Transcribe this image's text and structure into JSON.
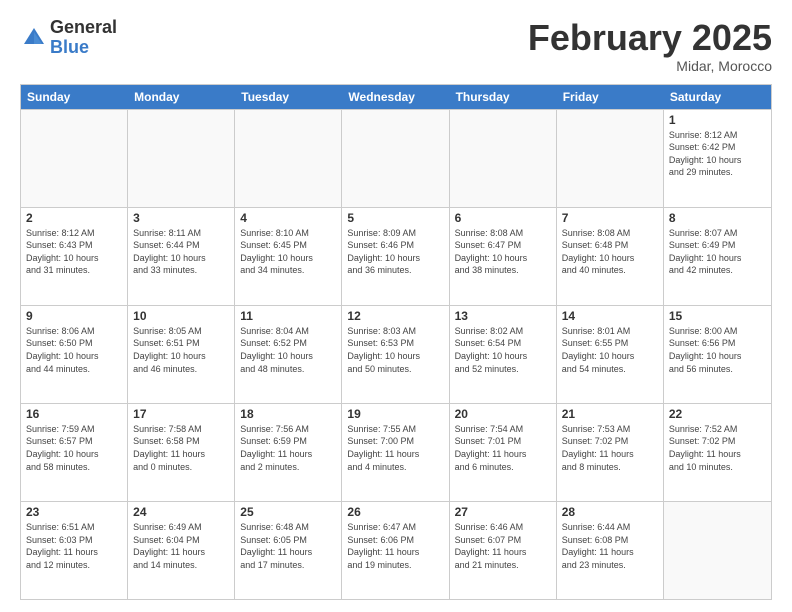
{
  "header": {
    "logo_general": "General",
    "logo_blue": "Blue",
    "title": "February 2025",
    "subtitle": "Midar, Morocco"
  },
  "calendar": {
    "days_of_week": [
      "Sunday",
      "Monday",
      "Tuesday",
      "Wednesday",
      "Thursday",
      "Friday",
      "Saturday"
    ],
    "rows": [
      [
        {
          "day": "",
          "info": "",
          "empty": true
        },
        {
          "day": "",
          "info": "",
          "empty": true
        },
        {
          "day": "",
          "info": "",
          "empty": true
        },
        {
          "day": "",
          "info": "",
          "empty": true
        },
        {
          "day": "",
          "info": "",
          "empty": true
        },
        {
          "day": "",
          "info": "",
          "empty": true
        },
        {
          "day": "1",
          "info": "Sunrise: 8:12 AM\nSunset: 6:42 PM\nDaylight: 10 hours\nand 29 minutes.",
          "empty": false
        }
      ],
      [
        {
          "day": "2",
          "info": "Sunrise: 8:12 AM\nSunset: 6:43 PM\nDaylight: 10 hours\nand 31 minutes.",
          "empty": false
        },
        {
          "day": "3",
          "info": "Sunrise: 8:11 AM\nSunset: 6:44 PM\nDaylight: 10 hours\nand 33 minutes.",
          "empty": false
        },
        {
          "day": "4",
          "info": "Sunrise: 8:10 AM\nSunset: 6:45 PM\nDaylight: 10 hours\nand 34 minutes.",
          "empty": false
        },
        {
          "day": "5",
          "info": "Sunrise: 8:09 AM\nSunset: 6:46 PM\nDaylight: 10 hours\nand 36 minutes.",
          "empty": false
        },
        {
          "day": "6",
          "info": "Sunrise: 8:08 AM\nSunset: 6:47 PM\nDaylight: 10 hours\nand 38 minutes.",
          "empty": false
        },
        {
          "day": "7",
          "info": "Sunrise: 8:08 AM\nSunset: 6:48 PM\nDaylight: 10 hours\nand 40 minutes.",
          "empty": false
        },
        {
          "day": "8",
          "info": "Sunrise: 8:07 AM\nSunset: 6:49 PM\nDaylight: 10 hours\nand 42 minutes.",
          "empty": false
        }
      ],
      [
        {
          "day": "9",
          "info": "Sunrise: 8:06 AM\nSunset: 6:50 PM\nDaylight: 10 hours\nand 44 minutes.",
          "empty": false
        },
        {
          "day": "10",
          "info": "Sunrise: 8:05 AM\nSunset: 6:51 PM\nDaylight: 10 hours\nand 46 minutes.",
          "empty": false
        },
        {
          "day": "11",
          "info": "Sunrise: 8:04 AM\nSunset: 6:52 PM\nDaylight: 10 hours\nand 48 minutes.",
          "empty": false
        },
        {
          "day": "12",
          "info": "Sunrise: 8:03 AM\nSunset: 6:53 PM\nDaylight: 10 hours\nand 50 minutes.",
          "empty": false
        },
        {
          "day": "13",
          "info": "Sunrise: 8:02 AM\nSunset: 6:54 PM\nDaylight: 10 hours\nand 52 minutes.",
          "empty": false
        },
        {
          "day": "14",
          "info": "Sunrise: 8:01 AM\nSunset: 6:55 PM\nDaylight: 10 hours\nand 54 minutes.",
          "empty": false
        },
        {
          "day": "15",
          "info": "Sunrise: 8:00 AM\nSunset: 6:56 PM\nDaylight: 10 hours\nand 56 minutes.",
          "empty": false
        }
      ],
      [
        {
          "day": "16",
          "info": "Sunrise: 7:59 AM\nSunset: 6:57 PM\nDaylight: 10 hours\nand 58 minutes.",
          "empty": false
        },
        {
          "day": "17",
          "info": "Sunrise: 7:58 AM\nSunset: 6:58 PM\nDaylight: 11 hours\nand 0 minutes.",
          "empty": false
        },
        {
          "day": "18",
          "info": "Sunrise: 7:56 AM\nSunset: 6:59 PM\nDaylight: 11 hours\nand 2 minutes.",
          "empty": false
        },
        {
          "day": "19",
          "info": "Sunrise: 7:55 AM\nSunset: 7:00 PM\nDaylight: 11 hours\nand 4 minutes.",
          "empty": false
        },
        {
          "day": "20",
          "info": "Sunrise: 7:54 AM\nSunset: 7:01 PM\nDaylight: 11 hours\nand 6 minutes.",
          "empty": false
        },
        {
          "day": "21",
          "info": "Sunrise: 7:53 AM\nSunset: 7:02 PM\nDaylight: 11 hours\nand 8 minutes.",
          "empty": false
        },
        {
          "day": "22",
          "info": "Sunrise: 7:52 AM\nSunset: 7:02 PM\nDaylight: 11 hours\nand 10 minutes.",
          "empty": false
        }
      ],
      [
        {
          "day": "23",
          "info": "Sunrise: 6:51 AM\nSunset: 6:03 PM\nDaylight: 11 hours\nand 12 minutes.",
          "empty": false
        },
        {
          "day": "24",
          "info": "Sunrise: 6:49 AM\nSunset: 6:04 PM\nDaylight: 11 hours\nand 14 minutes.",
          "empty": false
        },
        {
          "day": "25",
          "info": "Sunrise: 6:48 AM\nSunset: 6:05 PM\nDaylight: 11 hours\nand 17 minutes.",
          "empty": false
        },
        {
          "day": "26",
          "info": "Sunrise: 6:47 AM\nSunset: 6:06 PM\nDaylight: 11 hours\nand 19 minutes.",
          "empty": false
        },
        {
          "day": "27",
          "info": "Sunrise: 6:46 AM\nSunset: 6:07 PM\nDaylight: 11 hours\nand 21 minutes.",
          "empty": false
        },
        {
          "day": "28",
          "info": "Sunrise: 6:44 AM\nSunset: 6:08 PM\nDaylight: 11 hours\nand 23 minutes.",
          "empty": false
        },
        {
          "day": "",
          "info": "",
          "empty": true
        }
      ]
    ]
  }
}
